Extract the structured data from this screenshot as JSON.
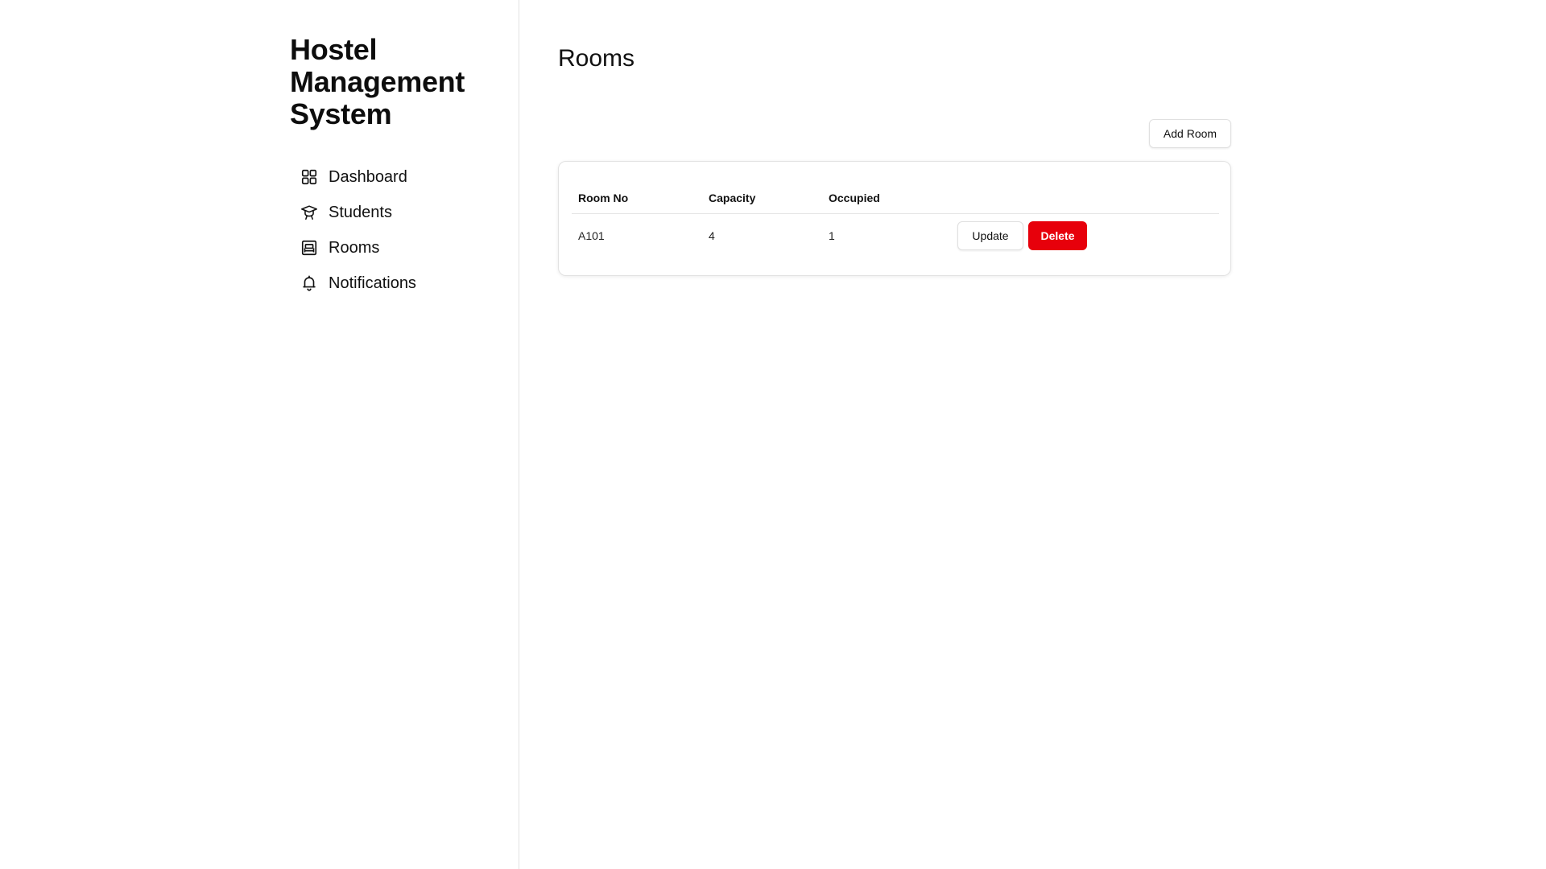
{
  "app": {
    "title": "Hostel Management System"
  },
  "sidebar": {
    "items": [
      {
        "label": "Dashboard",
        "icon": "dashboard-grid-icon"
      },
      {
        "label": "Students",
        "icon": "graduation-cap-icon"
      },
      {
        "label": "Rooms",
        "icon": "bed-icon"
      },
      {
        "label": "Notifications",
        "icon": "bell-icon"
      }
    ]
  },
  "main": {
    "title": "Rooms",
    "add_button_label": "Add Room",
    "table": {
      "headers": [
        "Room No",
        "Capacity",
        "Occupied",
        ""
      ],
      "rows": [
        {
          "room_no": "A101",
          "capacity": "4",
          "occupied": "1",
          "update_label": "Update",
          "delete_label": "Delete"
        }
      ]
    }
  },
  "colors": {
    "delete_button": "#e7000b",
    "border": "#e2e2e2",
    "text": "#111111"
  }
}
